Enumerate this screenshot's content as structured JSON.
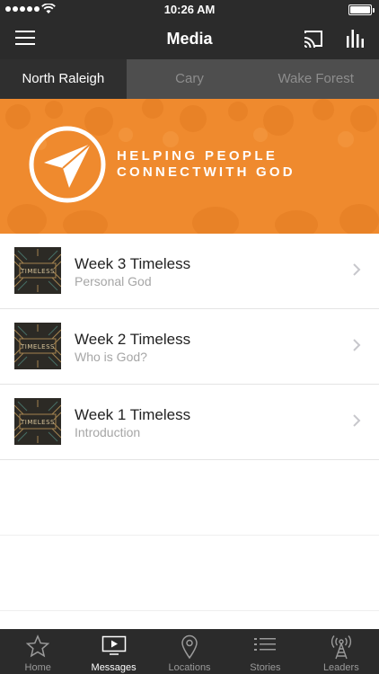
{
  "status_bar": {
    "time": "10:26 AM"
  },
  "nav": {
    "title": "Media",
    "menu_icon": "hamburger-menu-icon",
    "cast_icon": "cast-icon",
    "stats_icon": "bar-chart-icon"
  },
  "locations": [
    {
      "label": "North Raleigh",
      "active": true
    },
    {
      "label": "Cary",
      "active": false
    },
    {
      "label": "Wake Forest",
      "active": false
    }
  ],
  "banner": {
    "line1": "HELPING PEOPLE",
    "line2": "CONNECTWITH GOD",
    "color": "#EF8A2E"
  },
  "messages": [
    {
      "title": "Week 3 Timeless",
      "subtitle": "Personal God",
      "thumb_text": "TIMELESS"
    },
    {
      "title": "Week 2 Timeless",
      "subtitle": "Who is God?",
      "thumb_text": "TIMELESS"
    },
    {
      "title": "Week 1 Timeless",
      "subtitle": "Introduction",
      "thumb_text": "TIMELESS"
    }
  ],
  "tab_bar": [
    {
      "label": "Home",
      "icon": "star-icon",
      "active": false
    },
    {
      "label": "Messages",
      "icon": "play-screen-icon",
      "active": true
    },
    {
      "label": "Locations",
      "icon": "map-pin-icon",
      "active": false
    },
    {
      "label": "Stories",
      "icon": "list-icon",
      "active": false
    },
    {
      "label": "Leaders",
      "icon": "broadcast-tower-icon",
      "active": false
    }
  ]
}
